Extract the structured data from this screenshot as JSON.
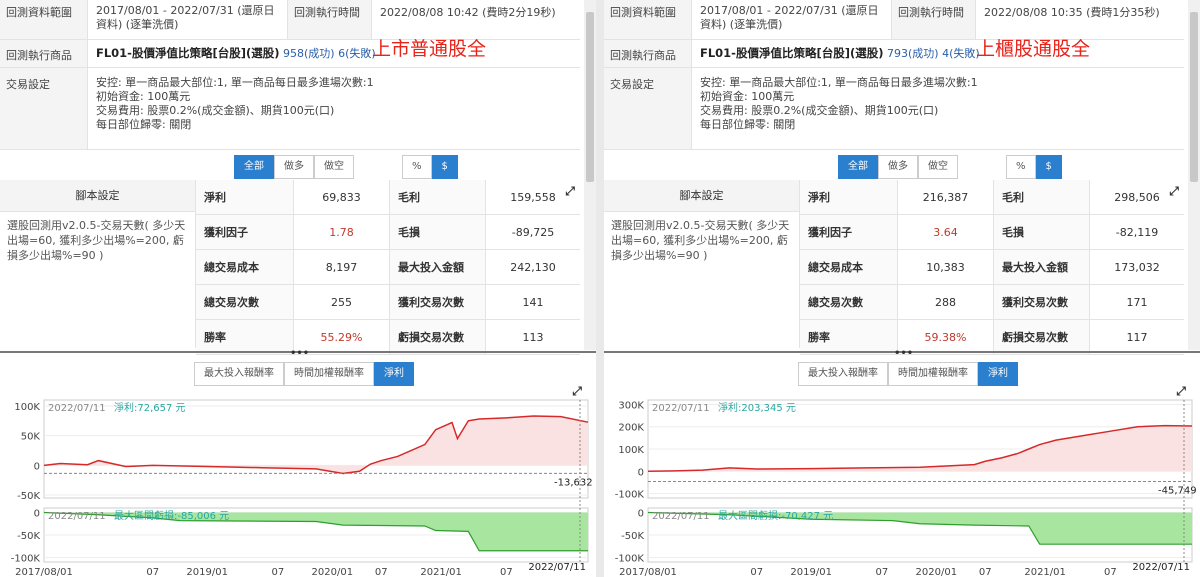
{
  "colors": {
    "accent": "#2a7fce",
    "profit_line": "#d62a2a",
    "area": "#fbe2e2",
    "green_line": "#2e9e2e",
    "green_fill": "#a8e6a0",
    "blue_seg": "#2a6fd4",
    "label_teal": "#2aa7a0"
  },
  "panels": [
    {
      "range_label": "回測資料範圍",
      "range_value": "2017/08/01 - 2022/07/31 (還原日資料) (逐筆洗價)",
      "exec_time_label": "回測執行時間",
      "exec_time_value": "2022/08/08 10:42 (費時2分19秒)",
      "product_label": "回測執行商品",
      "strategy": "FL01-股價淨值比策略[台股](選股)",
      "success": "958(成功)",
      "fail": "6(失敗)",
      "tag": "上市普通股全",
      "trade_label": "交易設定",
      "trade_lines": [
        "安控: 單一商品最大部位:1, 單一商品每日最多進場次數:1",
        "初始資金: 100萬元",
        "交易費用: 股票0.2%(成交金額)、期貨100元(口)",
        "每日部位歸零: 關閉"
      ],
      "filter_buttons": [
        "全部",
        "做多",
        "做空"
      ],
      "unit_buttons": [
        "%",
        "$"
      ],
      "script_header": "腳本設定",
      "script_body": "選股回測用v2.0.5-交易天數( 多少天出場=60, 獲利多少出場%=200, 虧損多少出場%=90 )",
      "stats": [
        [
          "淨利",
          "69,833",
          "毛利",
          "159,558"
        ],
        [
          "獲利因子",
          "1.78",
          "毛損",
          "-89,725"
        ],
        [
          "總交易成本",
          "8,197",
          "最大投入金額",
          "242,130"
        ],
        [
          "總交易次數",
          "255",
          "獲利交易次數",
          "141"
        ],
        [
          "勝率",
          "55.29%",
          "虧損交易次數",
          "113"
        ]
      ],
      "chart_tabs": [
        "最大投入報酬率",
        "時間加權報酬率",
        "淨利"
      ],
      "chart_data": {
        "type": "line",
        "top": {
          "date": "2022/07/11",
          "label": "淨利:",
          "value_text": "72,657 元",
          "yticks": [
            "100K",
            "50K",
            "0",
            "-50K"
          ],
          "ylim": [
            -55000,
            110000
          ],
          "min_label": "-13,632",
          "min_value": -13632
        },
        "bottom": {
          "date": "2022/07/11",
          "label": "最大區間虧損:",
          "value_text": "-85,006 元",
          "yticks": [
            "0",
            "-50K",
            "-100K"
          ],
          "ylim": [
            -110000,
            10000
          ]
        },
        "xticks": [
          "2017/08/01",
          "07",
          "2019/01",
          "07",
          "2020/01",
          "07",
          "2021/01",
          "07"
        ],
        "x_end_label": "2022/07/11",
        "profit_x": [
          0,
          0.03,
          0.08,
          0.1,
          0.15,
          0.2,
          0.3,
          0.4,
          0.5,
          0.55,
          0.58,
          0.6,
          0.62,
          0.65,
          0.7,
          0.72,
          0.75,
          0.76,
          0.78,
          0.8,
          0.85,
          0.9,
          0.95,
          1.0
        ],
        "profit_y": [
          0,
          3000,
          1000,
          8000,
          -2000,
          0,
          -2000,
          -4000,
          -6000,
          -13632,
          -10000,
          2000,
          8000,
          15000,
          35000,
          60000,
          72000,
          45000,
          75000,
          78000,
          80000,
          83000,
          82000,
          72657
        ],
        "dd_x": [
          0,
          0.1,
          0.2,
          0.25,
          0.5,
          0.55,
          0.7,
          0.72,
          0.78,
          0.8,
          1.0
        ],
        "dd_y": [
          0,
          -5000,
          -12000,
          -18000,
          -20000,
          -28000,
          -30000,
          -40000,
          -42000,
          -85006,
          -85006
        ]
      }
    },
    {
      "range_label": "回測資料範圍",
      "range_value": "2017/08/01 - 2022/07/31 (還原日資料) (逐筆洗價)",
      "exec_time_label": "回測執行時間",
      "exec_time_value": "2022/08/08 10:35 (費時1分35秒)",
      "product_label": "回測執行商品",
      "strategy": "FL01-股價淨值比策略[台股](選股)",
      "success": "793(成功)",
      "fail": "4(失敗)",
      "tag": "上櫃股通股全",
      "trade_label": "交易設定",
      "trade_lines": [
        "安控: 單一商品最大部位:1, 單一商品每日最多進場次數:1",
        "初始資金: 100萬元",
        "交易費用: 股票0.2%(成交金額)、期貨100元(口)",
        "每日部位歸零: 關閉"
      ],
      "filter_buttons": [
        "全部",
        "做多",
        "做空"
      ],
      "unit_buttons": [
        "%",
        "$"
      ],
      "script_header": "腳本設定",
      "script_body": "選股回測用v2.0.5-交易天數( 多少天出場=60, 獲利多少出場%=200, 虧損多少出場%=90 )",
      "stats": [
        [
          "淨利",
          "216,387",
          "毛利",
          "298,506"
        ],
        [
          "獲利因子",
          "3.64",
          "毛損",
          "-82,119"
        ],
        [
          "總交易成本",
          "10,383",
          "最大投入金額",
          "173,032"
        ],
        [
          "總交易次數",
          "288",
          "獲利交易次數",
          "171"
        ],
        [
          "勝率",
          "59.38%",
          "虧損交易次數",
          "117"
        ]
      ],
      "chart_tabs": [
        "最大投入報酬率",
        "時間加權報酬率",
        "淨利"
      ],
      "chart_data": {
        "type": "line",
        "top": {
          "date": "2022/07/11",
          "label": "淨利:",
          "value_text": "203,345 元",
          "yticks": [
            "300K",
            "200K",
            "100K",
            "0",
            "-100K"
          ],
          "ylim": [
            -120000,
            320000
          ],
          "min_label": "-45,749",
          "min_value": -45749
        },
        "bottom": {
          "date": "2022/07/11",
          "label": "最大區間虧損:",
          "value_text": "-70,427 元",
          "yticks": [
            "0",
            "-50K",
            "-100K"
          ],
          "ylim": [
            -110000,
            10000
          ]
        },
        "xticks": [
          "2017/08/01",
          "07",
          "2019/01",
          "07",
          "2020/01",
          "07",
          "2021/01",
          "07"
        ],
        "x_end_label": "2022/07/11",
        "profit_x": [
          0,
          0.05,
          0.1,
          0.15,
          0.2,
          0.3,
          0.4,
          0.5,
          0.6,
          0.62,
          0.65,
          0.68,
          0.7,
          0.72,
          0.75,
          0.8,
          0.85,
          0.9,
          0.95,
          1.0
        ],
        "profit_y": [
          0,
          2000,
          5000,
          15000,
          10000,
          12000,
          15000,
          18000,
          30000,
          45000,
          60000,
          80000,
          100000,
          120000,
          140000,
          160000,
          180000,
          200000,
          205000,
          203345
        ],
        "dd_x": [
          0,
          0.15,
          0.3,
          0.45,
          0.5,
          0.6,
          0.7,
          0.72,
          0.8,
          1.0
        ],
        "dd_y": [
          0,
          -5000,
          -15000,
          -18000,
          -25000,
          -28000,
          -30000,
          -70427,
          -70427,
          -70427
        ]
      }
    }
  ]
}
